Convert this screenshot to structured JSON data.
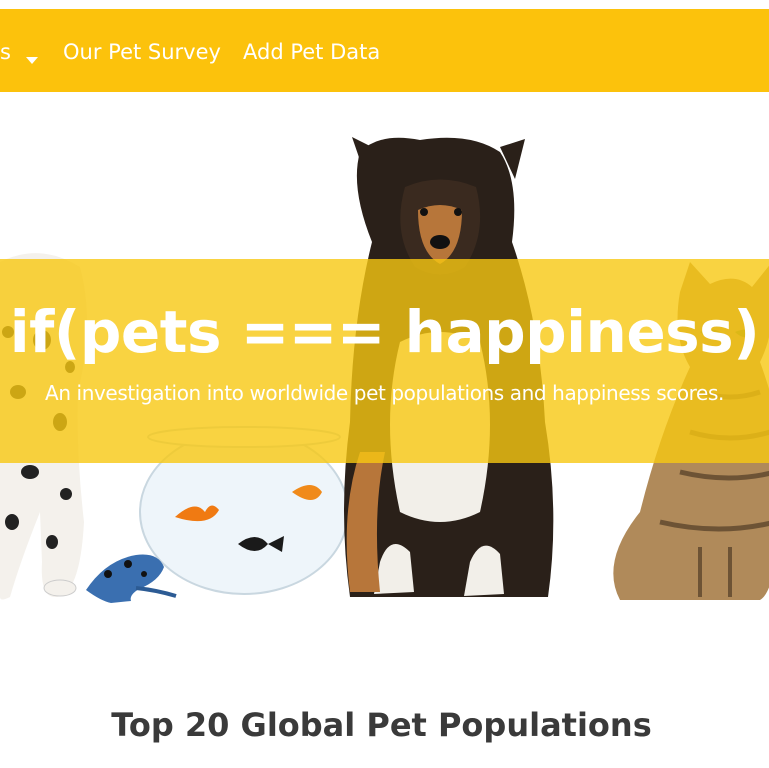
{
  "navbar": {
    "items": [
      {
        "label": "s"
      },
      {
        "label": "Our Pet Survey"
      },
      {
        "label": "Add Pet Data"
      }
    ],
    "background": "#fcc20c"
  },
  "hero": {
    "title": "if(pets === happiness)",
    "subtitle": "An investigation into worldwide pet populations and happiness scores.",
    "banner_color": "#f8c812",
    "image_subjects": [
      "dalmatian",
      "fishbowl-with-goldfish",
      "blue-frog",
      "collie-dog",
      "tabby-cat"
    ]
  },
  "main": {
    "section_title": "Top 20 Global Pet Populations"
  }
}
